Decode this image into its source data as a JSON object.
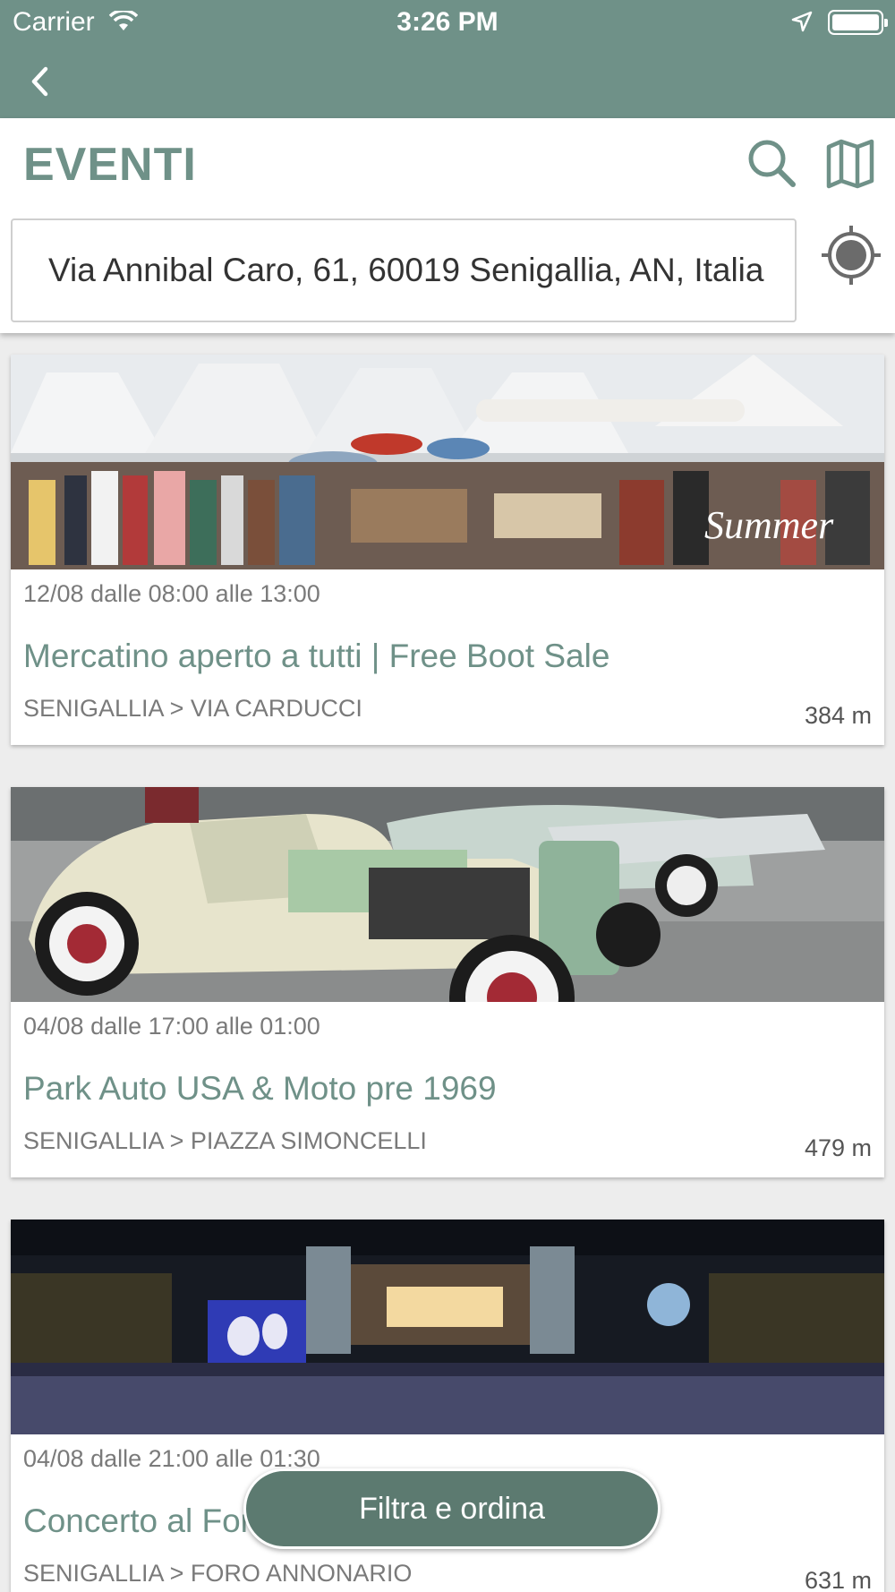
{
  "status_bar": {
    "carrier": "Carrier",
    "time": "3:26 PM"
  },
  "header": {
    "title": "EVENTI",
    "address": "Via Annibal Caro, 61, 60019 Senigallia, AN, Italia"
  },
  "events": [
    {
      "date": "12/08 dalle 08:00 alle 13:00",
      "name": "Mercatino aperto a tutti | Free Boot Sale",
      "place": "SENIGALLIA > VIA CARDUCCI",
      "distance": "384 m",
      "image_text": "Summer"
    },
    {
      "date": "04/08 dalle 17:00 alle 01:00",
      "name": "Park Auto USA & Moto pre 1969",
      "place": "SENIGALLIA > PIAZZA SIMONCELLI",
      "distance": "479 m"
    },
    {
      "date": "04/08 dalle 21:00 alle 01:30",
      "name": "Concerto al Foro",
      "place": "SENIGALLIA > FORO ANNONARIO",
      "distance": "631 m"
    }
  ],
  "filter_button": {
    "label": "Filtra e ordina"
  },
  "colors": {
    "accent": "#6f9188",
    "button": "#5c7a70"
  },
  "icons": {
    "back": "chevron-left-icon",
    "search": "search-icon",
    "map": "map-icon",
    "locate": "crosshair-icon"
  }
}
